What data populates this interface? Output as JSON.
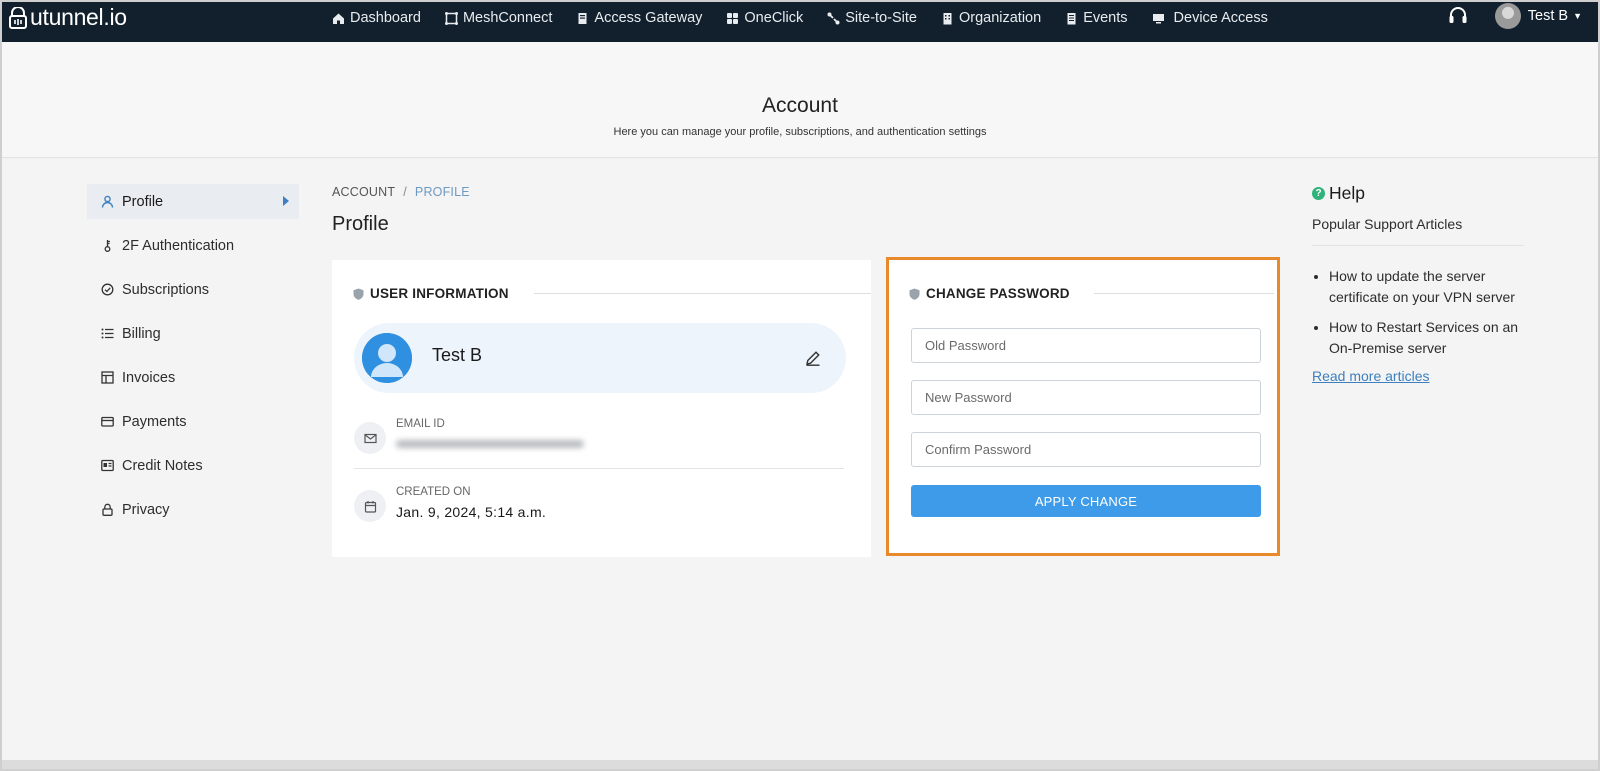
{
  "app": {
    "logo_text": "utunnel.io",
    "user_name": "Test B"
  },
  "nav": {
    "items": [
      {
        "label": "Dashboard",
        "icon": "home-icon"
      },
      {
        "label": "MeshConnect",
        "icon": "mesh-icon"
      },
      {
        "label": "Access Gateway",
        "icon": "gateway-icon"
      },
      {
        "label": "OneClick",
        "icon": "grid-icon"
      },
      {
        "label": "Site-to-Site",
        "icon": "link-icon"
      },
      {
        "label": "Organization",
        "icon": "building-icon"
      },
      {
        "label": "Events",
        "icon": "list-icon"
      },
      {
        "label": "Device Access",
        "icon": "monitor-icon"
      }
    ]
  },
  "header": {
    "title": "Account",
    "subtitle": "Here you can manage your profile, subscriptions, and authentication settings"
  },
  "sidebar": {
    "items": [
      {
        "label": "Profile",
        "icon": "user-icon",
        "active": true
      },
      {
        "label": "2F Authentication",
        "icon": "key-icon"
      },
      {
        "label": "Subscriptions",
        "icon": "check-circle-icon"
      },
      {
        "label": "Billing",
        "icon": "list-icon"
      },
      {
        "label": "Invoices",
        "icon": "table-icon"
      },
      {
        "label": "Payments",
        "icon": "card-icon"
      },
      {
        "label": "Credit Notes",
        "icon": "id-card-icon"
      },
      {
        "label": "Privacy",
        "icon": "lock-icon"
      }
    ]
  },
  "breadcrumb": {
    "root": "ACCOUNT",
    "separator": "/",
    "current": "PROFILE"
  },
  "main": {
    "heading": "Profile",
    "user_info": {
      "section_title": "USER INFORMATION",
      "full_name": "Test B",
      "email_label": "EMAIL ID",
      "email_value": "",
      "created_label": "CREATED ON",
      "created_value": "Jan. 9, 2024, 5:14 a.m."
    },
    "change_password": {
      "section_title": "CHANGE PASSWORD",
      "old_placeholder": "Old Password",
      "new_placeholder": "New Password",
      "confirm_placeholder": "Confirm Password",
      "apply_label": "APPLY CHANGE"
    }
  },
  "help": {
    "title": "Help",
    "subtitle": "Popular Support Articles",
    "articles": [
      "How to update the server certificate on your VPN server",
      "How to Restart Services on an On-Premise server"
    ],
    "read_more": "Read more articles"
  },
  "colors": {
    "topbar": "#12202d",
    "accent": "#3d9be9",
    "highlight_border": "#e8892b",
    "help_icon": "#2fb37a",
    "link": "#3d7fbf"
  }
}
